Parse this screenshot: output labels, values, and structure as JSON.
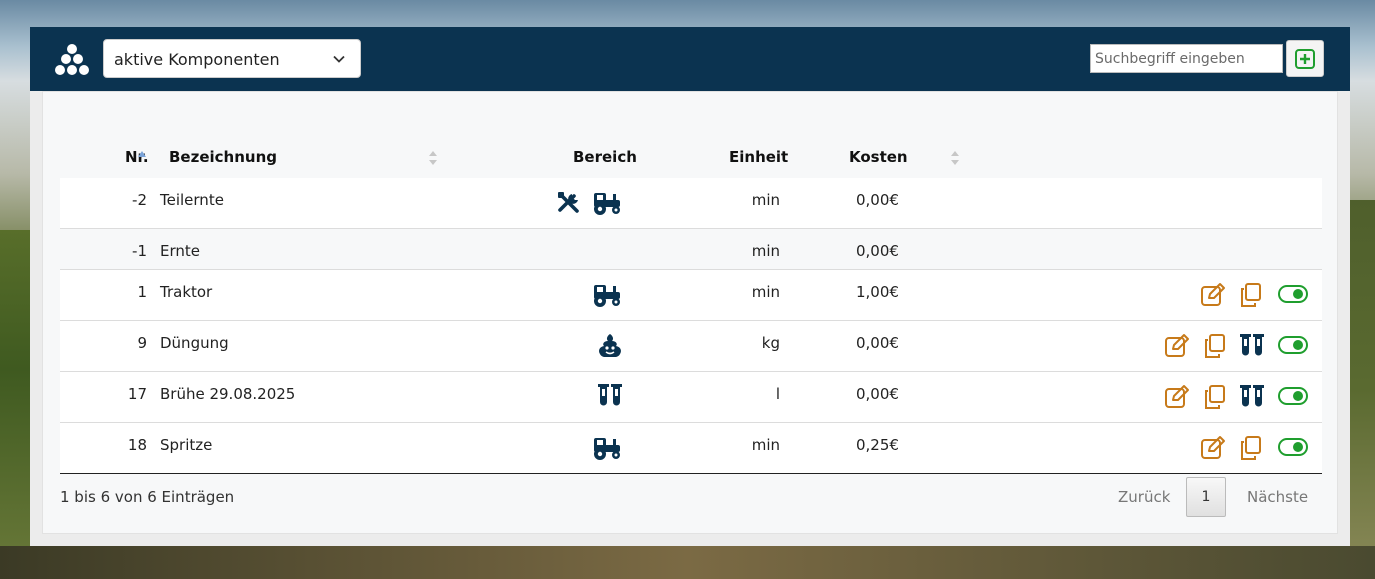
{
  "header": {
    "select_value": "aktive Komponenten",
    "search_placeholder": "Suchbegriff eingeben"
  },
  "table": {
    "columns": [
      "Nr.",
      "Bezeichnung",
      "Bereich",
      "Einheit",
      "Kosten"
    ],
    "rows": [
      {
        "nr": "-2",
        "name": "Teilernte",
        "bereich": [
          "tools-icon",
          "tractor-icon"
        ],
        "einheit": "min",
        "kosten": "0,00€",
        "actions": []
      },
      {
        "nr": "-1",
        "name": "Ernte",
        "bereich": [],
        "einheit": "min",
        "kosten": "0,00€",
        "actions": []
      },
      {
        "nr": "1",
        "name": "Traktor",
        "bereich": [
          "tractor-icon"
        ],
        "einheit": "min",
        "kosten": "1,00€",
        "actions": [
          "edit-icon",
          "copy-icon",
          "toggle-icon"
        ]
      },
      {
        "nr": "9",
        "name": "Düngung",
        "bereich": [
          "poop-icon"
        ],
        "einheit": "kg",
        "kosten": "0,00€",
        "actions": [
          "edit-icon",
          "copy-icon",
          "test-tubes-icon",
          "toggle-icon"
        ]
      },
      {
        "nr": "17",
        "name": "Brühe 29.08.2025",
        "bereich": [
          "test-tubes-icon"
        ],
        "einheit": "l",
        "kosten": "0,00€",
        "actions": [
          "edit-icon",
          "copy-icon",
          "test-tubes-icon",
          "toggle-icon"
        ]
      },
      {
        "nr": "18",
        "name": "Spritze",
        "bereich": [
          "tractor-icon"
        ],
        "einheit": "min",
        "kosten": "0,25€",
        "actions": [
          "edit-icon",
          "copy-icon",
          "toggle-icon"
        ]
      }
    ]
  },
  "footer": {
    "info": "1 bis 6 von 6 Einträgen",
    "prev": "Zurück",
    "page": "1",
    "next": "Nächste"
  },
  "colors": {
    "header_bg": "#0b3350",
    "icon_navy": "#0b3350",
    "action_orange": "#c77a1a",
    "toggle_green": "#1f9e2e",
    "add_green": "#1f9e2e"
  }
}
